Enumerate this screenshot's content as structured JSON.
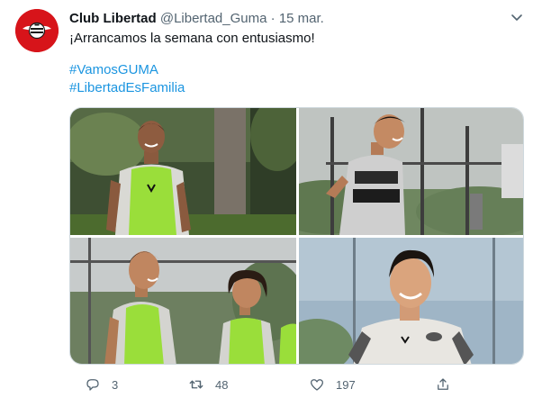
{
  "tweet": {
    "name": "Club Libertad",
    "handle": "@Libertad_Guma",
    "separator": "·",
    "date": "15 mar.",
    "text": "¡Arrancamos la semana con entusiasmo!",
    "hashtags": [
      "#VamosGUMA",
      "#LibertadEsFamilia"
    ]
  },
  "media": {
    "photos": [
      {
        "icon": "player-green-bib-smiling-photo"
      },
      {
        "icon": "player-black-vest-running-photo"
      },
      {
        "icon": "two-players-green-bibs-photo"
      },
      {
        "icon": "player-white-shirt-smiling-photo"
      }
    ]
  },
  "actions": {
    "reply_count": "3",
    "retweet_count": "48",
    "like_count": "197"
  },
  "colors": {
    "hashtag": "#1b95e0",
    "secondary_text": "#536471",
    "bib_green": "#9ade3a",
    "club_red": "#d7141a"
  }
}
